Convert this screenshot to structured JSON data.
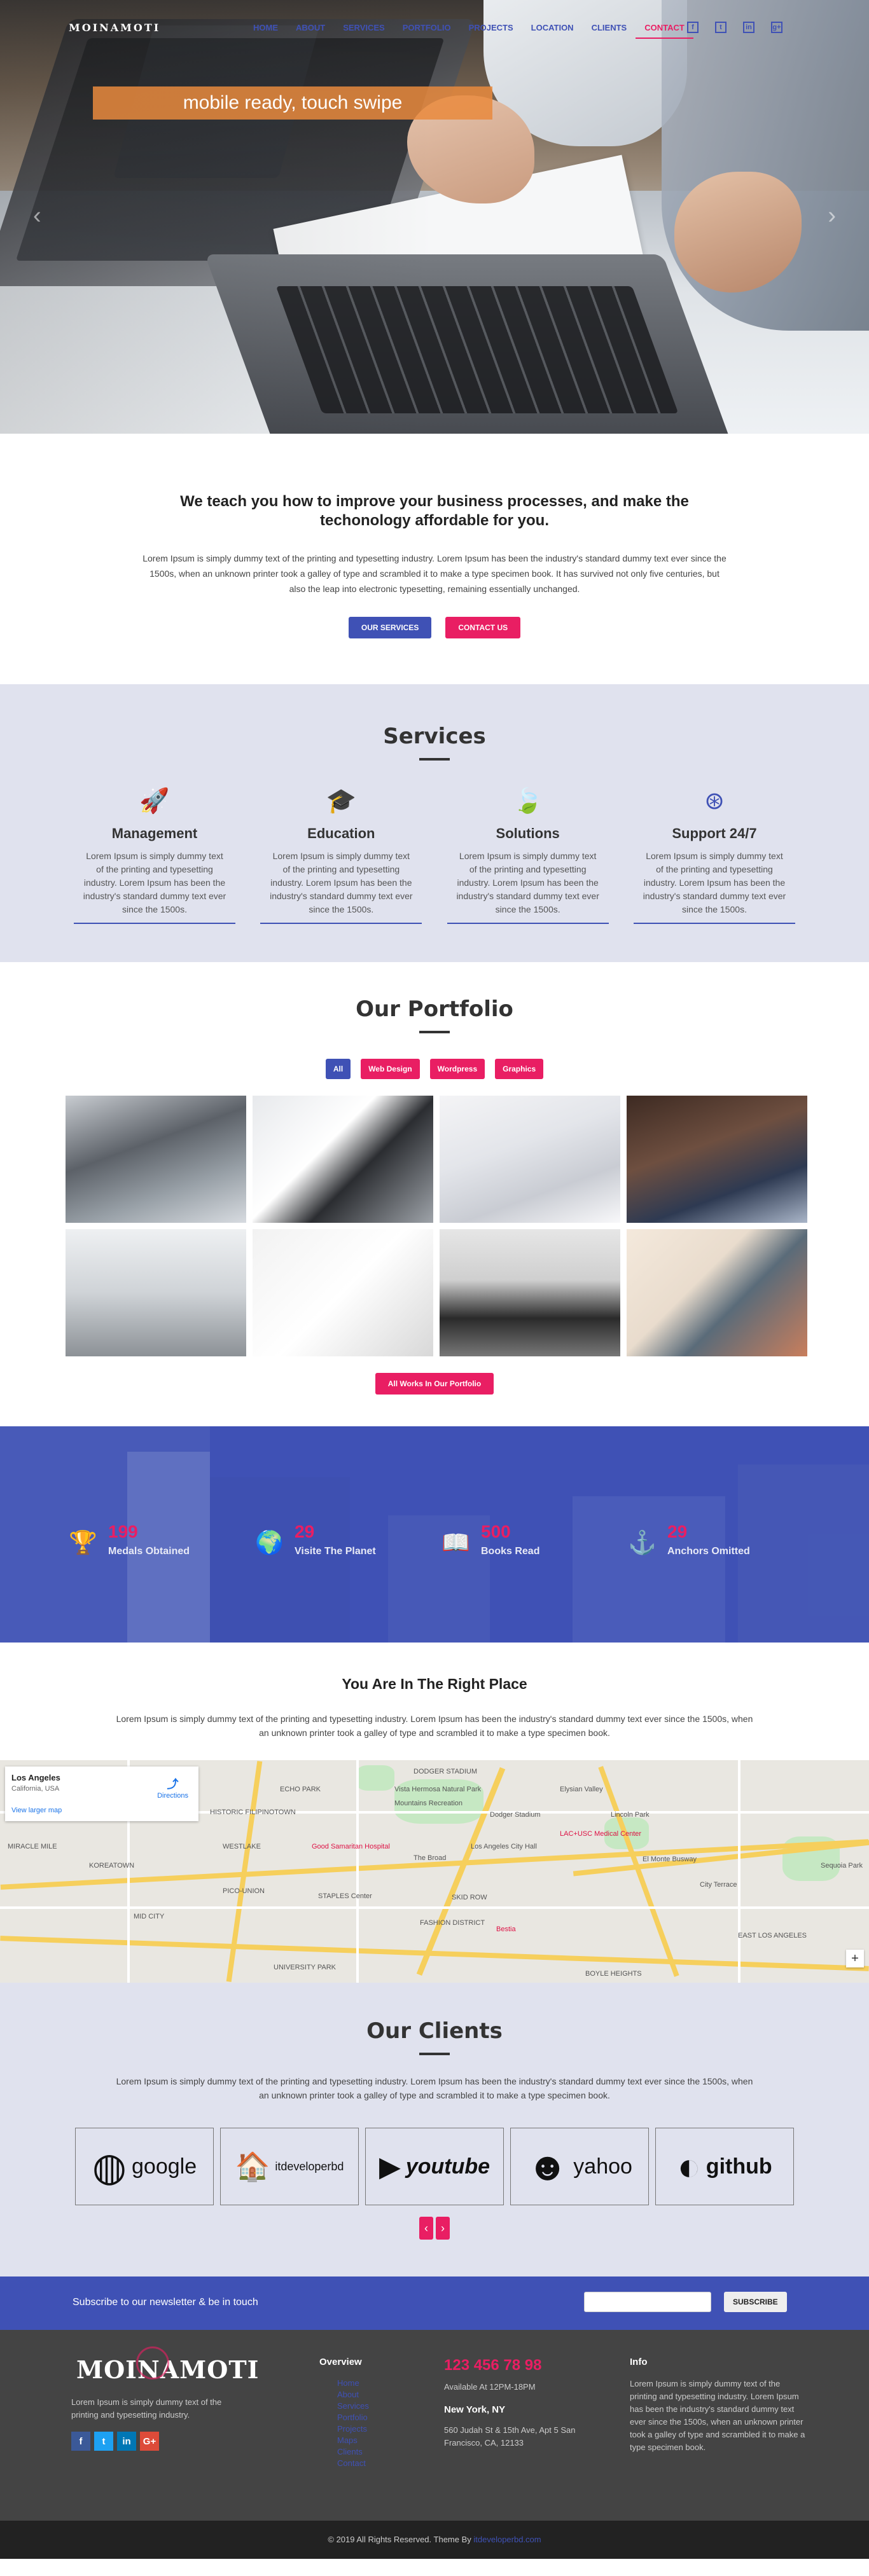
{
  "nav": {
    "logo": "MOINAMOTI",
    "items": [
      "HOME",
      "ABOUT",
      "SERVICES",
      "PORTFOLIO",
      "PROJECTS",
      "LOCATION",
      "CLIENTS",
      "CONTACT"
    ],
    "active": "CONTACT",
    "social": [
      "f",
      "t",
      "in",
      "g+"
    ]
  },
  "hero": {
    "caption": "mobile ready, touch swipe",
    "prev": "‹",
    "next": "›"
  },
  "intro": {
    "title": "We teach you how to improve your business processes, and make the techonology affordable for you.",
    "text": "Lorem Ipsum is simply dummy text of the printing and typesetting industry. Lorem Ipsum has been the industry's standard dummy text ever since the 1500s, when an unknown printer took a galley of type and scrambled it to make a type specimen book. It has survived not only five centuries, but also the leap into electronic typesetting, remaining essentially unchanged.",
    "btn_services": "OUR SERVICES",
    "btn_contact": "CONTACT US"
  },
  "services": {
    "title": "Services",
    "items": [
      {
        "icon": "rocket-icon",
        "glyph": "🚀",
        "title": "Management",
        "text": "Lorem Ipsum is simply dummy text of the printing and typesetting industry. Lorem Ipsum has been the industry's standard dummy text ever since the 1500s."
      },
      {
        "icon": "graduation-cap-icon",
        "glyph": "🎓",
        "title": "Education",
        "text": "Lorem Ipsum is simply dummy text of the printing and typesetting industry. Lorem Ipsum has been the industry's standard dummy text ever since the 1500s."
      },
      {
        "icon": "leaf-icon",
        "glyph": "🍃",
        "title": "Solutions",
        "text": "Lorem Ipsum is simply dummy text of the printing and typesetting industry. Lorem Ipsum has been the industry's standard dummy text ever since the 1500s."
      },
      {
        "icon": "lifebuoy-icon",
        "glyph": "⊛",
        "title": "Support 24/7",
        "text": "Lorem Ipsum is simply dummy text of the printing and typesetting industry. Lorem Ipsum has been the industry's standard dummy text ever since the 1500s."
      }
    ]
  },
  "portfolio": {
    "title": "Our Portfolio",
    "filters": [
      "All",
      "Web Design",
      "Wordpress",
      "Graphics"
    ],
    "active_filter": "All",
    "all_works": "All Works In Our Portfolio"
  },
  "stats": [
    {
      "icon": "trophy-icon",
      "glyph": "🏆",
      "num": "199",
      "label": "Medals Obtained"
    },
    {
      "icon": "globe-icon",
      "glyph": "🌍",
      "num": "29",
      "label": "Visite The Planet"
    },
    {
      "icon": "book-icon",
      "glyph": "📖",
      "num": "500",
      "label": "Books Read"
    },
    {
      "icon": "anchor-icon",
      "glyph": "⚓",
      "num": "29",
      "label": "Anchors Omitted"
    }
  ],
  "location": {
    "title": "You Are In The Right Place",
    "text": "Lorem Ipsum is simply dummy text of the printing and typesetting industry. Lorem Ipsum has been the industry's standard dummy text ever since the 1500s, when an unknown printer took a galley of type and scrambled it to make a type specimen book.",
    "map": {
      "place": "Los Angeles",
      "region": "California, USA",
      "directions": "Directions",
      "larger": "View larger map",
      "labels": [
        "DODGER STADIUM",
        "ECHO PARK",
        "Dodger Stadium",
        "Vista Hermosa Natural Park",
        "Mountains Recreation",
        "Elysian Valley",
        "Lincoln Park",
        "HISTORIC FILIPINOTOWN",
        "Good Samaritan Hospital",
        "The Broad",
        "Los Angeles City Hall",
        "LAC+USC Medical Center",
        "El Monte Busway",
        "MIRACLE MILE",
        "KOREATOWN",
        "WESTLAKE",
        "City Terrace",
        "Sequoia Park",
        "STAPLES Center",
        "SKID ROW",
        "MID CITY",
        "FASHION DISTRICT",
        "Bestia",
        "EAST LOS ANGELES",
        "UNIVERSITY PARK",
        "BOYLE HEIGHTS",
        "PICO-UNION"
      ]
    }
  },
  "clients": {
    "title": "Our Clients",
    "text": "Lorem Ipsum is simply dummy text of the printing and typesetting industry. Lorem Ipsum has been the industry's standard dummy text ever since the 1500s, when an unknown printer took a galley of type and scrambled it to make a type specimen book.",
    "logos": [
      {
        "name": "google",
        "icon": "google-logo-icon",
        "glyph": "◍"
      },
      {
        "name": "itdeveloperbd",
        "icon": "itdeveloperbd-logo-icon",
        "glyph": "🏠"
      },
      {
        "name": "youtube",
        "icon": "youtube-logo-icon",
        "glyph": "▶"
      },
      {
        "name": "yahoo",
        "icon": "yahoo-logo-icon",
        "glyph": "☻"
      },
      {
        "name": "github",
        "icon": "github-logo-icon",
        "glyph": "◐"
      }
    ],
    "prev": "‹",
    "next": "›"
  },
  "newsletter": {
    "text": "Subscribe to our newsletter & be in touch",
    "placeholder": "",
    "button": "SUBSCRIBE"
  },
  "footer": {
    "logo": "MOINAMOTI",
    "desc": "Lorem Ipsum is simply dummy text of the printing and typesetting industry.",
    "social": [
      "f",
      "t",
      "in",
      "G+"
    ],
    "overview_title": "Overview",
    "overview_links": [
      "Home",
      "About",
      "Services",
      "Portfolio",
      "Projects",
      "Maps",
      "Clients",
      "Contact"
    ],
    "phone": "123 456 78 98",
    "hours": "Available At 12PM-18PM",
    "city": "New York, NY",
    "address": "560 Judah St & 15th Ave, Apt 5 San Francisco, CA, 12133",
    "info_title": "Info",
    "info_text": "Lorem Ipsum is simply dummy text of the printing and typesetting industry. Lorem Ipsum has been the industry's standard dummy text ever since the 1500s, when an unknown printer took a galley of type and scrambled it to make a type specimen book."
  },
  "copyright": {
    "text": "© 2019 All Rights Reserved. Theme By ",
    "link": "itdeveloperbd.com"
  },
  "colors": {
    "primary": "#3f51b5",
    "accent": "#e91e63",
    "light_bg": "#e0e2ee",
    "footer_bg": "#444444"
  }
}
